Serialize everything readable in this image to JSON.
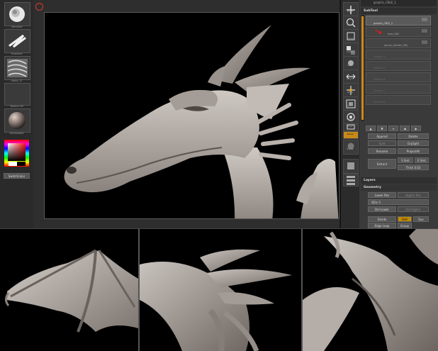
{
  "app": {
    "title": "graphic_CBLE_1",
    "accent_color": "#d08a16"
  },
  "left_toolbar": {
    "tools": [
      {
        "label": "Standard",
        "icon": "standard-brush-icon"
      },
      {
        "label": "Freehand",
        "icon": "freehand-stroke-icon"
      },
      {
        "label": "Alpha_12",
        "icon": "alpha-texture-icon"
      },
      {
        "label": "Texture Off",
        "icon": "texture-off-icon"
      },
      {
        "label": "SkinShade4",
        "icon": "material-sphere-icon"
      }
    ],
    "switch_color_label": "SwitchColor"
  },
  "mid_toolbar": {
    "buttons": [
      {
        "label": "Scroll",
        "icon": "scroll-icon"
      },
      {
        "label": "Zoom",
        "icon": "zoom-icon"
      },
      {
        "label": "Actual",
        "icon": "actual-size-icon"
      },
      {
        "label": "AAHalf",
        "icon": "aahalf-icon"
      },
      {
        "label": "Local",
        "icon": "local-symmetry-icon"
      },
      {
        "label": "L.Sym",
        "icon": "l-sym-icon"
      },
      {
        "label": "Move",
        "icon": "move-icon"
      },
      {
        "label": "Scale",
        "icon": "scale-icon"
      },
      {
        "label": "Rotate",
        "icon": "rotate-icon"
      },
      {
        "label": "PolyF",
        "icon": "polyframe-icon"
      },
      {
        "label": "Xpose",
        "icon": "xpose-icon"
      },
      {
        "label": "Transp",
        "icon": "transparency-icon"
      },
      {
        "label": "Solo",
        "icon": "solo-icon"
      }
    ]
  },
  "right_panel": {
    "header_title": "graphic_CBLE_1",
    "subtool_header": "SubTool",
    "subtools": [
      {
        "name": "graphic_CBLE_1",
        "active": true
      },
      {
        "name": "eyes_OBJ",
        "active": false
      },
      {
        "name": "parras_dientes_OBJ",
        "active": false
      },
      {
        "name": "Subtool 4",
        "active": false
      },
      {
        "name": "Subtool 5",
        "active": false
      },
      {
        "name": "Subtool 6",
        "active": false
      },
      {
        "name": "Subtool 7",
        "active": false
      },
      {
        "name": "Subtool 8",
        "active": false
      }
    ],
    "buttons": {
      "append": "Append",
      "delete": "Delete",
      "split": "Split",
      "grp_split": "GrpSplit",
      "rename": "Rename",
      "project_all": "ProjectAll",
      "extract": "Extract",
      "s_smt": "S Smt",
      "e_smt": "E Smt",
      "thick": "Thick 0.02"
    },
    "layers_header": "Layers",
    "geometry_header": "Geometry",
    "geometry": {
      "lower_res": "Lower Res",
      "higher_res": "Higher Res",
      "sdiv": "SDiv 5",
      "del_lower": "Del Lower",
      "del_higher": "Del Higher",
      "divide": "Divide",
      "smt": "Smt",
      "suv": "Suv",
      "edge_loop": "Edge Loop",
      "group": "Group"
    }
  },
  "bottom_views": [
    {
      "name": "wing-view"
    },
    {
      "name": "head-horns-view"
    },
    {
      "name": "back-wing-view"
    }
  ]
}
